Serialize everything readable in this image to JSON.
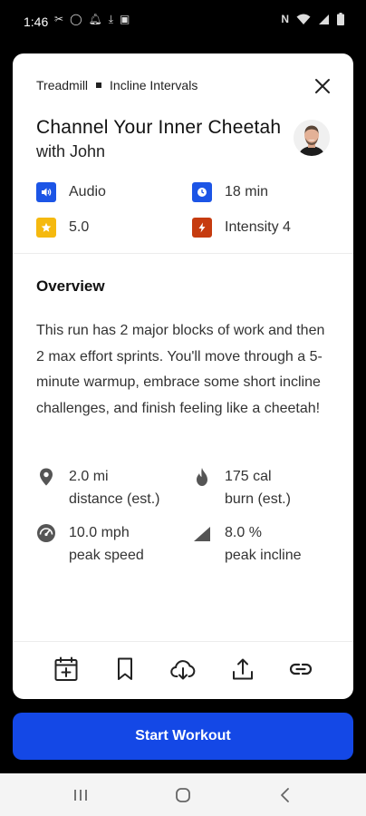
{
  "status_bar": {
    "time": "1:46",
    "icons": [
      "scissors-icon",
      "circle-icon",
      "bell-icon",
      "download-icon",
      "sim-icon",
      "nfc-icon",
      "wifi-icon",
      "signal-icon",
      "battery-icon"
    ]
  },
  "card": {
    "breadcrumb": {
      "category": "Treadmill",
      "type": "Incline Intervals"
    },
    "title": "Channel Your Inner Cheetah",
    "subtitle": "with John",
    "meta": {
      "audio": "Audio",
      "duration": "18 min",
      "rating": "5.0",
      "intensity": "Intensity 4"
    },
    "overview": {
      "heading": "Overview",
      "text": "This run has 2 major blocks of work and then 2 max effort sprints. You'll move through a 5-minute warmup, embrace some short incline challenges, and finish feeling like a cheetah!"
    },
    "stats": {
      "distance_value": "2.0 mi",
      "distance_label": "distance (est.)",
      "calories_value": "175 cal",
      "calories_label": "burn (est.)",
      "speed_value": "10.0 mph",
      "speed_label": "peak speed",
      "incline_value": "8.0 %",
      "incline_label": "peak incline"
    },
    "actions": [
      "calendar-add-icon",
      "bookmark-icon",
      "cloud-download-icon",
      "share-icon",
      "link-icon"
    ]
  },
  "start_button": {
    "label": "Start Workout"
  },
  "colors": {
    "audio_badge": "#1c55e6",
    "duration_badge": "#1c55e6",
    "rating_badge": "#f5b90f",
    "intensity_badge": "#c63b0f",
    "primary": "#1448e6"
  }
}
